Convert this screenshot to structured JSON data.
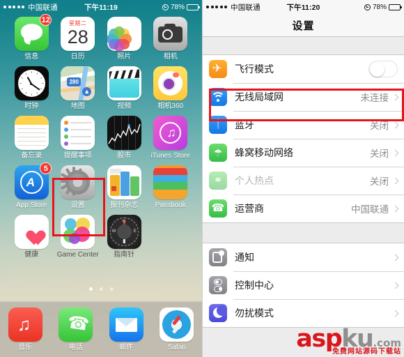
{
  "home": {
    "statusbar": {
      "carrier": "中国联通",
      "time": "下午11:19",
      "battery_pct": "78%",
      "signal_dots": 5,
      "alarm_icon": "alarm-clock-icon",
      "battery_icon": "battery-icon"
    },
    "apps": [
      {
        "label": "信息",
        "icon": "messages-icon",
        "badge": "12"
      },
      {
        "label": "日历",
        "icon": "calendar-icon",
        "day": "星期二",
        "date": "28"
      },
      {
        "label": "照片",
        "icon": "photos-icon"
      },
      {
        "label": "相机",
        "icon": "camera-icon"
      },
      {
        "label": "时钟",
        "icon": "clock-icon"
      },
      {
        "label": "地图",
        "icon": "maps-icon",
        "road_shield": "280"
      },
      {
        "label": "视频",
        "icon": "videos-icon"
      },
      {
        "label": "相机360",
        "icon": "camera360-icon"
      },
      {
        "label": "备忘录",
        "icon": "notes-icon"
      },
      {
        "label": "提醒事项",
        "icon": "reminders-icon"
      },
      {
        "label": "股市",
        "icon": "stocks-icon"
      },
      {
        "label": "iTunes Store",
        "icon": "itunes-store-icon"
      },
      {
        "label": "App Store",
        "icon": "app-store-icon",
        "badge": "5"
      },
      {
        "label": "设置",
        "icon": "settings-icon",
        "highlighted": true
      },
      {
        "label": "报刊杂志",
        "icon": "newsstand-icon"
      },
      {
        "label": "Passbook",
        "icon": "passbook-icon"
      },
      {
        "label": "健康",
        "icon": "health-icon"
      },
      {
        "label": "Game Center",
        "icon": "game-center-icon"
      },
      {
        "label": "指南针",
        "icon": "compass-icon"
      }
    ],
    "page_dots": {
      "count": 3,
      "active": 1
    },
    "dock": [
      {
        "label": "音乐",
        "icon": "music-icon"
      },
      {
        "label": "电话",
        "icon": "phone-icon"
      },
      {
        "label": "邮件",
        "icon": "mail-icon"
      },
      {
        "label": "Safari",
        "icon": "safari-icon"
      }
    ],
    "highlight_color": "#e8131a"
  },
  "settings": {
    "statusbar": {
      "carrier": "中国联通",
      "time": "下午11:20",
      "battery_pct": "78%",
      "signal_dots": 5,
      "alarm_icon": "alarm-clock-icon",
      "battery_icon": "battery-icon"
    },
    "navbar": {
      "title": "设置"
    },
    "group1": [
      {
        "label": "飞行模式",
        "icon": "airplane-mode-icon",
        "control": "toggle",
        "toggle_on": false
      },
      {
        "label": "无线局域网",
        "icon": "wifi-icon",
        "value": "未连接",
        "control": "chevron",
        "highlighted": true
      },
      {
        "label": "蓝牙",
        "icon": "bluetooth-icon",
        "value": "关闭",
        "control": "chevron"
      },
      {
        "label": "蜂窝移动网络",
        "icon": "cellular-icon",
        "value": "关闭",
        "control": "chevron"
      },
      {
        "label": "个人热点",
        "icon": "personal-hotspot-icon",
        "value": "关闭",
        "control": "chevron",
        "dimmed": true
      },
      {
        "label": "运营商",
        "icon": "carrier-icon",
        "value": "中国联通",
        "control": "chevron"
      }
    ],
    "group2": [
      {
        "label": "通知",
        "icon": "notifications-icon",
        "value": "",
        "control": "chevron"
      },
      {
        "label": "控制中心",
        "icon": "control-center-icon",
        "value": "",
        "control": "chevron"
      },
      {
        "label": "勿扰模式",
        "icon": "do-not-disturb-icon",
        "value": "",
        "control": "chevron"
      }
    ],
    "highlight_color": "#e8131a"
  },
  "watermark": {
    "part1": "asp",
    "part2": "ku",
    "part3": ".com",
    "subtitle": "免费网站源码下载站"
  }
}
